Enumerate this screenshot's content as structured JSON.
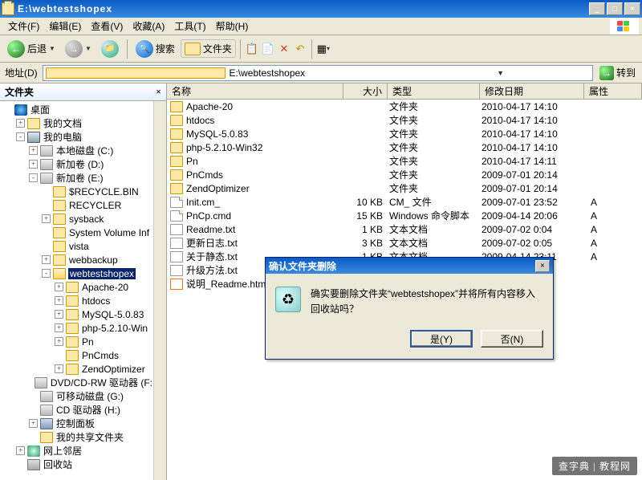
{
  "window": {
    "title": "E:\\webtestshopex",
    "min": "_",
    "max": "□",
    "close": "×"
  },
  "menu": {
    "file": "文件(F)",
    "edit": "编辑(E)",
    "view": "查看(V)",
    "favorites": "收藏(A)",
    "tools": "工具(T)",
    "help": "帮助(H)"
  },
  "toolbar": {
    "back": "后退",
    "search": "搜索",
    "folders": "文件夹"
  },
  "address": {
    "label": "地址(D)",
    "path": "E:\\webtestshopex",
    "go": "转到"
  },
  "left": {
    "header": "文件夹",
    "nodes": {
      "desktop": "桌面",
      "mydoc": "我的文档",
      "mycomp": "我的电脑",
      "drive_c": "本地磁盘 (C:)",
      "drive_d": "新加卷 (D:)",
      "drive_e": "新加卷 (E:)",
      "recycle_bin": "$RECYCLE.BIN",
      "recycler": "RECYCLER",
      "sysback": "sysback",
      "svi": "System Volume Inf",
      "vista": "vista",
      "webbackup": "webbackup",
      "webtestshopex": "webtestshopex",
      "apache": "Apache-20",
      "htdocs": "htdocs",
      "mysql": "MySQL-5.0.83",
      "php": "php-5.2.10-Win",
      "pn": "Pn",
      "pncmds": "PnCmds",
      "zend": "ZendOptimizer",
      "dvd": "DVD/CD-RW 驱动器 (F:",
      "rem_g": "可移动磁盘 (G:)",
      "cd_h": "CD 驱动器 (H:)",
      "ctrl": "控制面板",
      "shared": "我的共享文件夹",
      "netplaces": "网上邻居",
      "recyclebin": "回收站"
    }
  },
  "columns": {
    "name": "名称",
    "size": "大小",
    "type": "类型",
    "date": "修改日期",
    "attr": "属性"
  },
  "files": [
    {
      "icon": "folder",
      "name": "Apache-20",
      "size": "",
      "type": "文件夹",
      "date": "2010-04-17 14:10",
      "attr": ""
    },
    {
      "icon": "folder",
      "name": "htdocs",
      "size": "",
      "type": "文件夹",
      "date": "2010-04-17 14:10",
      "attr": ""
    },
    {
      "icon": "folder",
      "name": "MySQL-5.0.83",
      "size": "",
      "type": "文件夹",
      "date": "2010-04-17 14:10",
      "attr": ""
    },
    {
      "icon": "folder",
      "name": "php-5.2.10-Win32",
      "size": "",
      "type": "文件夹",
      "date": "2010-04-17 14:10",
      "attr": ""
    },
    {
      "icon": "folder",
      "name": "Pn",
      "size": "",
      "type": "文件夹",
      "date": "2010-04-17 14:11",
      "attr": ""
    },
    {
      "icon": "folder",
      "name": "PnCmds",
      "size": "",
      "type": "文件夹",
      "date": "2009-07-01 20:14",
      "attr": ""
    },
    {
      "icon": "folder",
      "name": "ZendOptimizer",
      "size": "",
      "type": "文件夹",
      "date": "2009-07-01 20:14",
      "attr": ""
    },
    {
      "icon": "file",
      "name": "Init.cm_",
      "size": "10 KB",
      "type": "CM_ 文件",
      "date": "2009-07-01 23:52",
      "attr": "A"
    },
    {
      "icon": "file",
      "name": "PnCp.cmd",
      "size": "15 KB",
      "type": "Windows 命令脚本",
      "date": "2009-04-14 20:06",
      "attr": "A"
    },
    {
      "icon": "txt",
      "name": "Readme.txt",
      "size": "1 KB",
      "type": "文本文档",
      "date": "2009-07-02 0:04",
      "attr": "A"
    },
    {
      "icon": "txt",
      "name": "更新日志.txt",
      "size": "3 KB",
      "type": "文本文档",
      "date": "2009-07-02 0:05",
      "attr": "A"
    },
    {
      "icon": "txt",
      "name": "关于静态.txt",
      "size": "1 KB",
      "type": "文本文档",
      "date": "2009-04-14 23:11",
      "attr": "A"
    },
    {
      "icon": "txt",
      "name": "升级方法.txt",
      "size": "",
      "type": "",
      "date": "",
      "attr": ""
    },
    {
      "icon": "html",
      "name": "说明_Readme.htm",
      "size": "",
      "type": "",
      "date": "",
      "attr": ""
    }
  ],
  "dialog": {
    "title": "确认文件夹删除",
    "text": "确实要删除文件夹“webtestshopex”并将所有内容移入回收站吗？",
    "yes": "是(Y)",
    "no": "否(N)"
  },
  "watermark": {
    "a": "查字典",
    "b": "教程网"
  }
}
